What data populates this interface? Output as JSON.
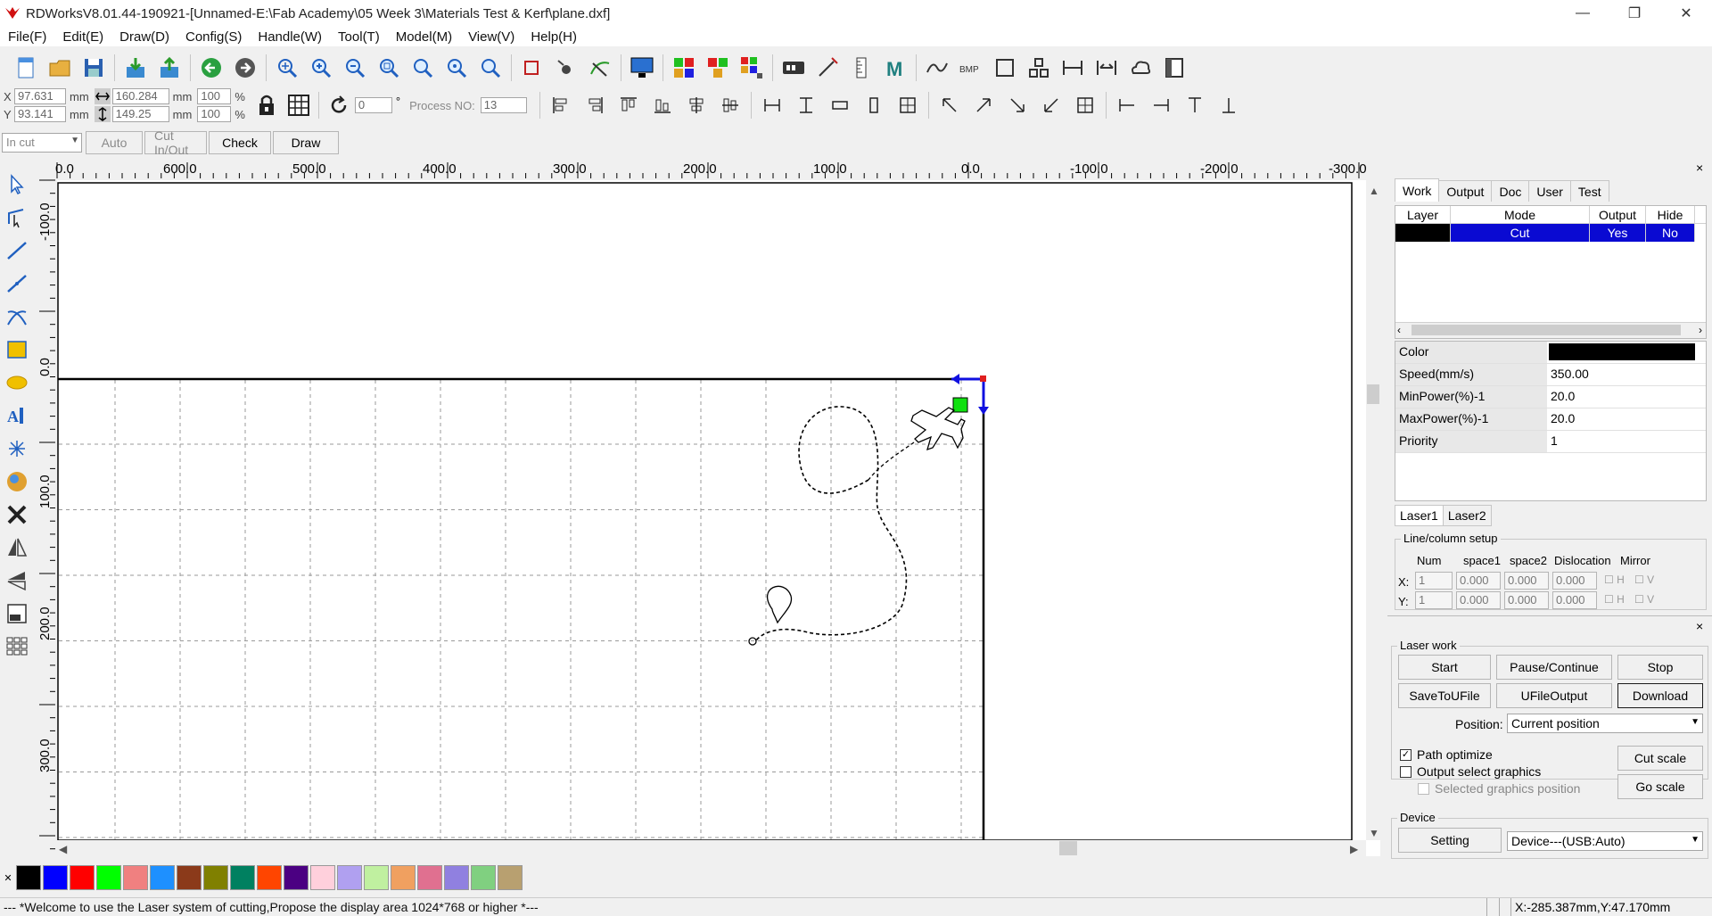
{
  "window": {
    "title": "RDWorksV8.01.44-190921-[Unnamed-E:\\Fab Academy\\05 Week 3\\Materials Test & Kerf\\plane.dxf]",
    "minimize": "—",
    "maximize": "❐",
    "close": "✕"
  },
  "menu": [
    "File(F)",
    "Edit(E)",
    "Draw(D)",
    "Config(S)",
    "Handle(W)",
    "Tool(T)",
    "Model(M)",
    "View(V)",
    "Help(H)"
  ],
  "coords": {
    "x_label": "X",
    "y_label": "Y",
    "x_value": "97.631",
    "y_value": "93.141",
    "unit": "mm",
    "width_value": "160.284",
    "height_value": "149.25",
    "scale_x": "100",
    "scale_y": "100",
    "percent": "%",
    "rotate_value": "0",
    "degree": "°",
    "process_label": "Process NO:",
    "process_value": "13"
  },
  "row3": {
    "mode_select": "In cut",
    "auto_label": "Auto",
    "cutinout_label": "Cut In/Out",
    "check_label": "Check",
    "draw_label": "Draw"
  },
  "ruler": {
    "top_labels": [
      "0.0",
      "600.0",
      "500.0",
      "400.0",
      "300.0",
      "200.0",
      "100.0",
      "0.0",
      "-100.0",
      "-200.0",
      "-300.0"
    ],
    "left_labels": [
      "-100.0",
      "0.0",
      "100.0",
      "200.0",
      "300.0"
    ]
  },
  "right_panel": {
    "close": "×",
    "tabs": [
      "Work",
      "Output",
      "Doc",
      "User",
      "Test"
    ],
    "layer_headers": [
      "Layer",
      "Mode",
      "Output",
      "Hide"
    ],
    "layer_row": {
      "mode": "Cut",
      "output": "Yes",
      "hide": "No",
      "color": "#000000"
    },
    "props": [
      {
        "name": "Color",
        "value": ""
      },
      {
        "name": "Speed(mm/s)",
        "value": "350.00"
      },
      {
        "name": "MinPower(%)-1",
        "value": "20.0"
      },
      {
        "name": "MaxPower(%)-1",
        "value": "20.0"
      },
      {
        "name": "Priority",
        "value": "1"
      }
    ],
    "laser_tabs": [
      "Laser1",
      "Laser2"
    ],
    "line_column": {
      "title": "Line/column setup",
      "headers": [
        "Num",
        "space1",
        "space2",
        "Dislocation",
        "Mirror"
      ],
      "x_label": "X:",
      "y_label": "Y:",
      "x_values": [
        "1",
        "0.000",
        "0.000",
        "0.000"
      ],
      "y_values": [
        "1",
        "0.000",
        "0.000",
        "0.000"
      ],
      "mirror_h": "H",
      "mirror_v": "V"
    },
    "laser_work": {
      "close": "×",
      "title": "Laser work",
      "start": "Start",
      "pause": "Pause/Continue",
      "stop": "Stop",
      "save_ufile": "SaveToUFile",
      "ufile_output": "UFileOutput",
      "download": "Download",
      "position_label": "Position:",
      "position_value": "Current position",
      "path_optimize": "Path optimize",
      "output_select": "Output select graphics",
      "selected_position": "Selected graphics position",
      "cut_scale": "Cut scale",
      "go_scale": "Go scale"
    },
    "device": {
      "title": "Device",
      "setting": "Setting",
      "device_value": "Device---(USB:Auto)"
    }
  },
  "palette": [
    "#000000",
    "#0000ff",
    "#ff0000",
    "#00ff00",
    "#f08080",
    "#1e90ff",
    "#8b3a1a",
    "#808000",
    "#008060",
    "#ff4500",
    "#4b0082",
    "#ffd0dc",
    "#b0a0f0",
    "#c0f0a0",
    "#f0a060",
    "#e07090",
    "#9080e0",
    "#80d080",
    "#b8a070"
  ],
  "status": {
    "message": "--- *Welcome to use the Laser system of cutting,Propose the display area 1024*768 or higher *---",
    "coords": "X:-285.387mm,Y:47.170mm"
  }
}
